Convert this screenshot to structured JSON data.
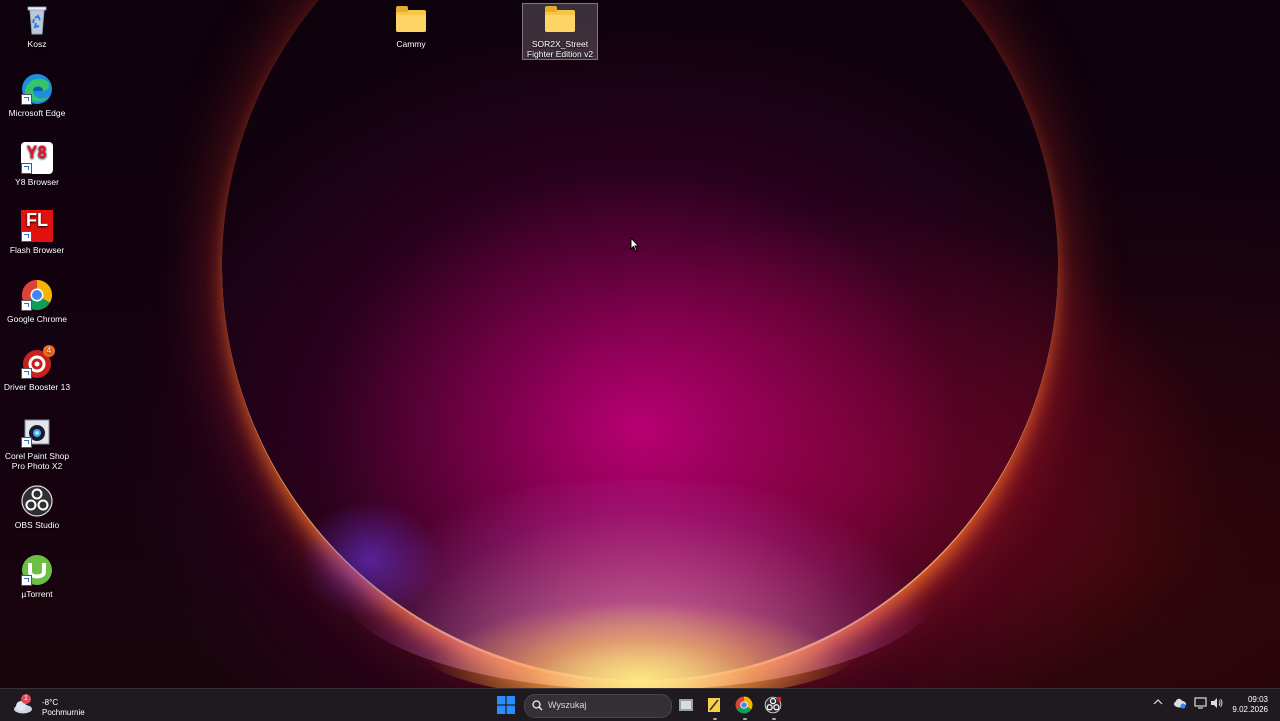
{
  "desktop": {
    "icons": [
      {
        "label": "Kosz"
      },
      {
        "label": "Microsoft Edge"
      },
      {
        "label": "Y8 Browser"
      },
      {
        "label": "Flash Browser"
      },
      {
        "label": "Google Chrome"
      },
      {
        "label": "Driver Booster 13"
      },
      {
        "label": "Corel Paint Shop Pro Photo X2"
      },
      {
        "label": "OBS Studio"
      },
      {
        "label": "µTorrent"
      },
      {
        "label": "Cammy"
      },
      {
        "label": "SOR2X_Street Fighter Edition v2"
      }
    ],
    "flash_letters": "FL",
    "y8_letters": "Y8",
    "driver_booster_badge": "4"
  },
  "taskbar": {
    "weather": {
      "temperature": "-8°C",
      "condition": "Pochmurnie",
      "alert": "1"
    },
    "search_placeholder": "Wyszukaj",
    "clock": {
      "time": "09:03",
      "date": "9.02.2026"
    }
  },
  "colors": {
    "accent": "#2b8cff",
    "folder": "#f7c548",
    "taskbar": "#1f1a1f"
  }
}
